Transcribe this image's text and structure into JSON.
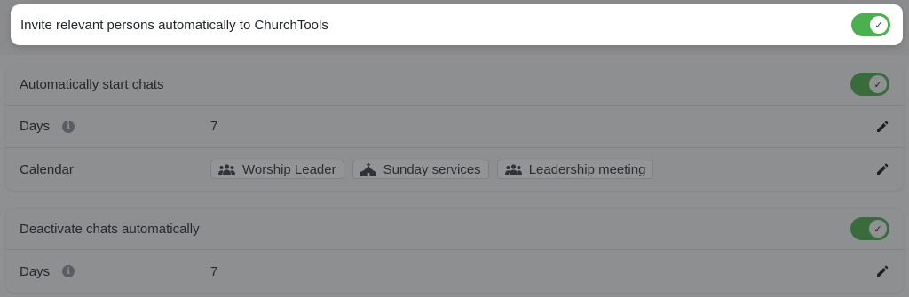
{
  "invite_setting": {
    "label": "Invite relevant persons automatically to ChurchTools",
    "enabled": true
  },
  "start_chats": {
    "title": "Automatically start chats",
    "enabled": true,
    "days_label": "Days",
    "days_value": "7",
    "calendar_label": "Calendar",
    "calendars": [
      {
        "name": "Worship Leader",
        "icon": "group-icon"
      },
      {
        "name": "Sunday services",
        "icon": "church-icon"
      },
      {
        "name": "Leadership meeting",
        "icon": "group-icon"
      }
    ]
  },
  "deactivate_chats": {
    "title": "Deactivate chats automatically",
    "enabled": true,
    "days_label": "Days",
    "days_value": "7"
  },
  "colors": {
    "toggle_on": "#4caf50",
    "backdrop": "#8f9092",
    "highlight": "#ffffff"
  }
}
